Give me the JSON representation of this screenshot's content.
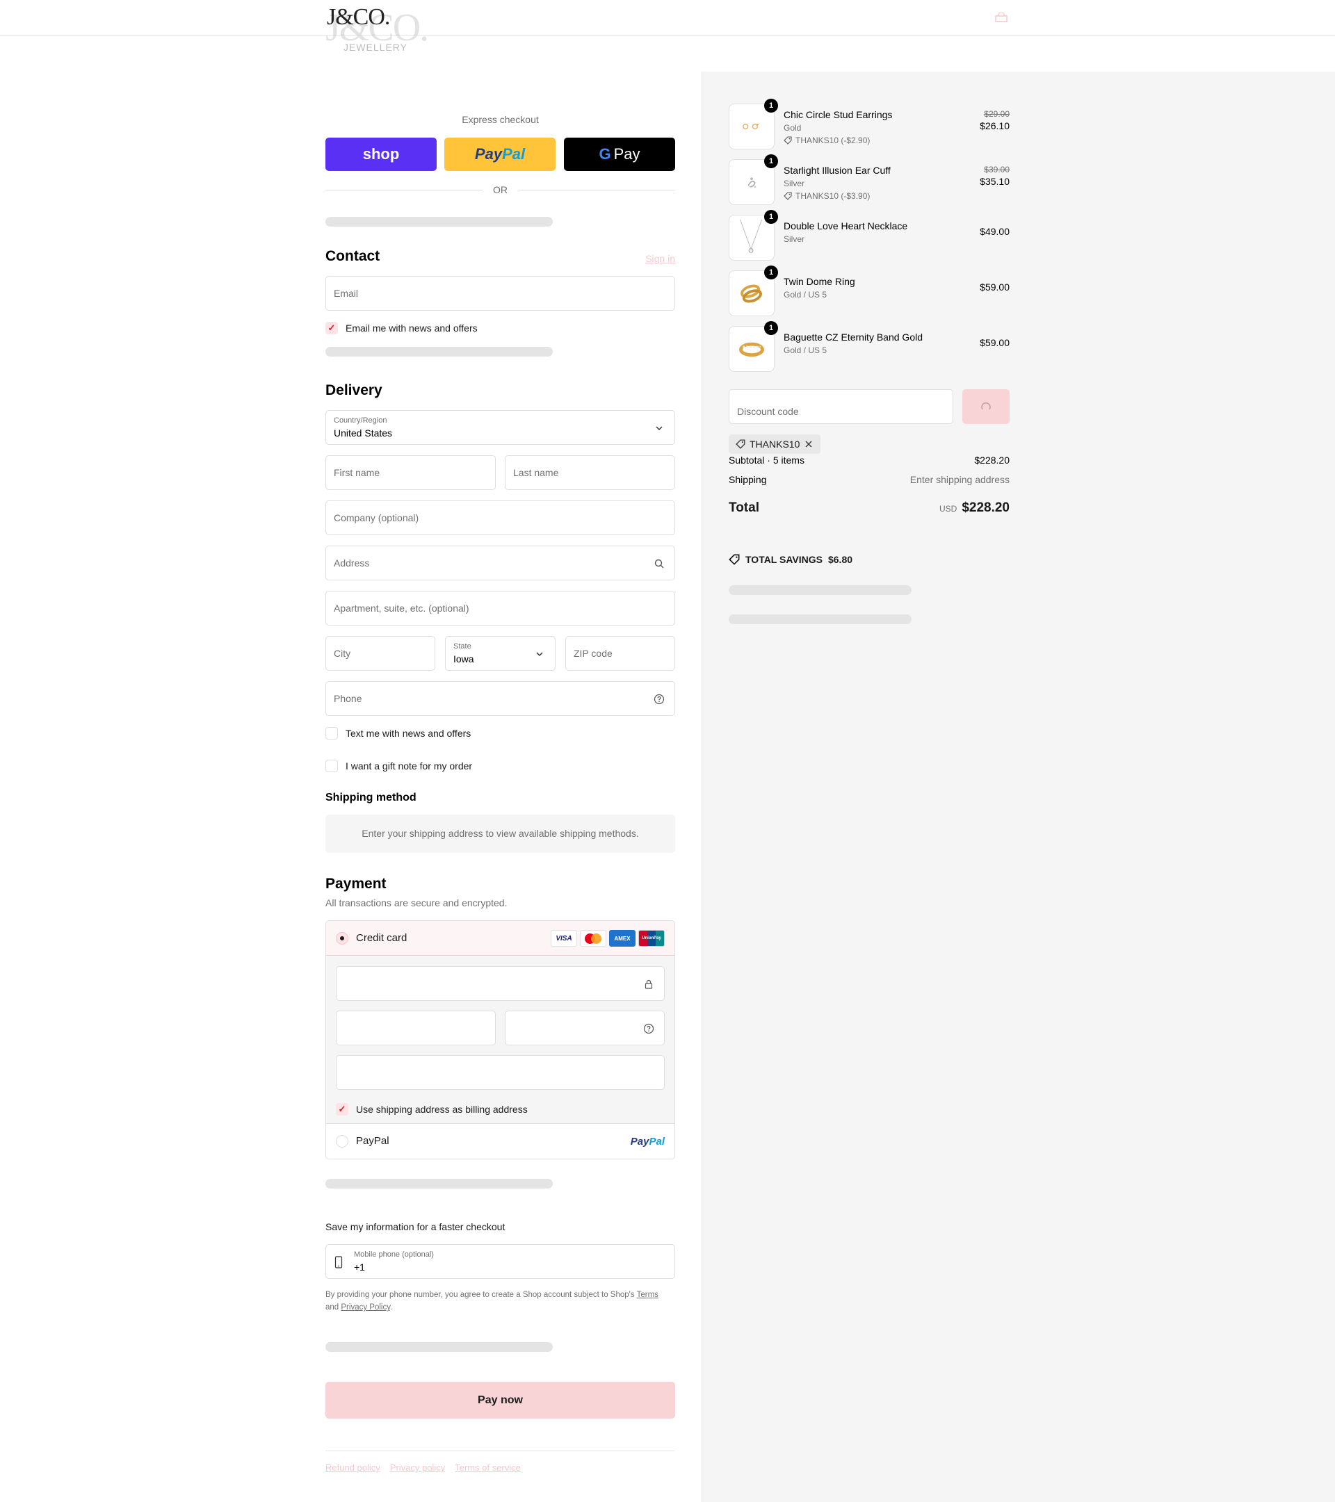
{
  "brand": {
    "logo_main": "J&CO.",
    "logo_sub": "JEWELLERY"
  },
  "express": {
    "title": "Express checkout",
    "shop_label": "shop",
    "paypal_a": "Pay",
    "paypal_b": "Pal",
    "gpay_g": "G",
    "gpay_label": "Pay",
    "or": "OR"
  },
  "contact": {
    "heading": "Contact",
    "sign_in": "Sign in",
    "email_placeholder": "Email",
    "email_news": "Email me with news and offers"
  },
  "delivery": {
    "heading": "Delivery",
    "country_label": "Country/Region",
    "country_value": "United States",
    "first_name": "First name",
    "last_name": "Last name",
    "company": "Company (optional)",
    "address": "Address",
    "apartment": "Apartment, suite, etc. (optional)",
    "city": "City",
    "state_label": "State",
    "state_value": "Iowa",
    "zip": "ZIP code",
    "phone": "Phone",
    "text_news": "Text me with news and offers",
    "gift_note": "I want a gift note for my order"
  },
  "shipping": {
    "heading": "Shipping method",
    "note": "Enter your shipping address to view available shipping methods."
  },
  "payment": {
    "heading": "Payment",
    "subtitle": "All transactions are secure and encrypted.",
    "credit_card": "Credit card",
    "card_logos": [
      "VISA",
      "mastercard",
      "AMEX",
      "UnionPay"
    ],
    "billing_same": "Use shipping address as billing address",
    "paypal": "PayPal",
    "paypal_logo_a": "Pay",
    "paypal_logo_b": "Pal"
  },
  "save": {
    "heading": "Save my information for a faster checkout",
    "mobile_label": "Mobile phone (optional)",
    "mobile_value": "+1",
    "legal_1": "By providing your phone number, you agree to create a Shop account subject to Shop's ",
    "terms": "Terms",
    "legal_2": "and ",
    "privacy": "Privacy Policy",
    "legal_end": "."
  },
  "pay_now": "Pay now",
  "footer": {
    "refund": "Refund policy",
    "privacy": "Privacy policy",
    "terms": "Terms of service"
  },
  "cart": {
    "items": [
      {
        "qty": "1",
        "name": "Chic Circle Stud Earrings",
        "variant": "Gold",
        "discount": "THANKS10 (-$2.90)",
        "old_price": "$29.00",
        "price": "$26.10"
      },
      {
        "qty": "1",
        "name": "Starlight Illusion Ear Cuff",
        "variant": "Silver",
        "discount": "THANKS10 (-$3.90)",
        "old_price": "$39.00",
        "price": "$35.10"
      },
      {
        "qty": "1",
        "name": "Double Love Heart Necklace",
        "variant": "Silver",
        "price": "$49.00"
      },
      {
        "qty": "1",
        "name": "Twin Dome Ring",
        "variant": "Gold / US 5",
        "price": "$59.00"
      },
      {
        "qty": "1",
        "name": "Baguette CZ Eternity Band Gold",
        "variant": "Gold / US 5",
        "price": "$59.00"
      }
    ],
    "discount_placeholder": "Discount code",
    "applied_code": "THANKS10",
    "subtotal_label": "Subtotal · 5 items",
    "subtotal": "$228.20",
    "shipping_label": "Shipping",
    "shipping_value": "Enter shipping address",
    "total_label": "Total",
    "currency": "USD",
    "total": "$228.20",
    "savings_label": "TOTAL SAVINGS",
    "savings": "$6.80"
  },
  "colors": {
    "accent_pink": "#f9d4d6",
    "shop_purple": "#5a31f4",
    "paypal_yellow": "#ffc439"
  }
}
